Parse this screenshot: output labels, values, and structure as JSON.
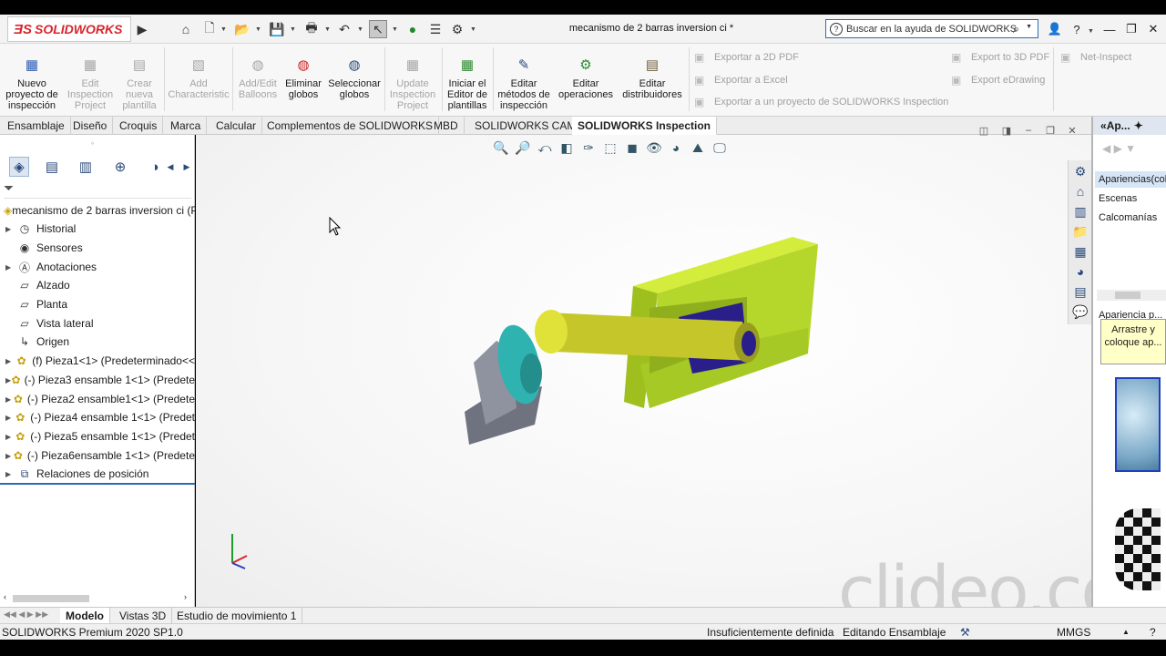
{
  "app": {
    "brand": "SOLIDWORKS",
    "document_title": "mecanismo de 2 barras inversion ci *",
    "search_placeholder": "Buscar en la ayuda de SOLIDWORKS"
  },
  "ribbon": {
    "buttons": [
      {
        "label": "Nuevo proyecto de inspección",
        "enabled": true
      },
      {
        "label": "Edit Inspection Project",
        "enabled": false
      },
      {
        "label": "Crear nueva plantilla",
        "enabled": false
      },
      {
        "label": "Add Characteristic",
        "enabled": false
      },
      {
        "label": "Add/Edit Balloons",
        "enabled": false
      },
      {
        "label": "Eliminar globos",
        "enabled": true
      },
      {
        "label": "Seleccionar globos",
        "enabled": true
      },
      {
        "label": "Update Inspection Project",
        "enabled": false
      },
      {
        "label": "Iniciar el Editor de plantillas",
        "enabled": true
      },
      {
        "label": "Editar métodos de inspección",
        "enabled": true
      },
      {
        "label": "Editar operaciones",
        "enabled": true
      },
      {
        "label": "Editar distribuidores",
        "enabled": true
      }
    ],
    "export_items": {
      "pdf2d": "Exportar a 2D PDF",
      "excel": "Exportar a Excel",
      "inspection": "Exportar a un proyecto de SOLIDWORKS Inspection",
      "pdf3d": "Export to 3D PDF",
      "edrawing": "Export eDrawing",
      "netinspect": "Net-Inspect"
    }
  },
  "command_tabs": [
    "Ensamblaje",
    "Diseño",
    "Croquis",
    "Marca",
    "Calcular",
    "Complementos de SOLIDWORKS",
    "MBD",
    "SOLIDWORKS CAM",
    "SOLIDWORKS Inspection"
  ],
  "active_tab": "SOLIDWORKS Inspection",
  "feature_tree": {
    "root": "mecanismo de 2 barras inversion ci  (P",
    "items": [
      {
        "label": "Historial",
        "expandable": true,
        "icon": "history-icon"
      },
      {
        "label": "Sensores",
        "expandable": false,
        "icon": "sensor-icon"
      },
      {
        "label": "Anotaciones",
        "expandable": true,
        "icon": "annotation-icon"
      },
      {
        "label": "Alzado",
        "expandable": false,
        "icon": "plane-icon"
      },
      {
        "label": "Planta",
        "expandable": false,
        "icon": "plane-icon"
      },
      {
        "label": "Vista lateral",
        "expandable": false,
        "icon": "plane-icon"
      },
      {
        "label": "Origen",
        "expandable": false,
        "icon": "origin-icon"
      },
      {
        "label": "(f) Pieza1<1> (Predeterminado<<",
        "expandable": true,
        "icon": "part-icon"
      },
      {
        "label": "(-) Pieza3 ensamble 1<1> (Predete",
        "expandable": true,
        "icon": "part-icon"
      },
      {
        "label": "(-) Pieza2 ensamble1<1> (Predete",
        "expandable": true,
        "icon": "part-icon"
      },
      {
        "label": "(-) Pieza4 ensamble 1<1> (Predet",
        "expandable": true,
        "icon": "part-icon"
      },
      {
        "label": "(-) Pieza5 ensamble 1<1> (Predet",
        "expandable": true,
        "icon": "part-icon"
      },
      {
        "label": "(-) Pieza6ensamble 1<1> (Predete",
        "expandable": true,
        "icon": "part-icon"
      },
      {
        "label": "Relaciones de posición",
        "expandable": true,
        "icon": "mate-icon"
      }
    ]
  },
  "task_pane": {
    "header": "Ap...",
    "items": [
      "Apariencias(col",
      "Escenas",
      "Calcomanías"
    ],
    "section_title": "Apariencia p...",
    "tooltip": "Arrastre y coloque ap..."
  },
  "bottom_tabs": [
    "Modelo",
    "Vistas 3D",
    "Estudio de movimiento 1"
  ],
  "active_bottom_tab": "Modelo",
  "status": {
    "version": "SOLIDWORKS Premium 2020 SP1.0",
    "definition": "Insuficientemente definida",
    "mode": "Editando Ensamblaje",
    "units": "MMGS"
  },
  "watermark": "clideo.com",
  "colors": {
    "brand_red": "#d8262c",
    "lime_part": "#b5d62a",
    "teal_part": "#2fb3b0",
    "olive_bar": "#c4c62a",
    "gray_base": "#6f7380",
    "navy_slot": "#2a1f8a"
  }
}
